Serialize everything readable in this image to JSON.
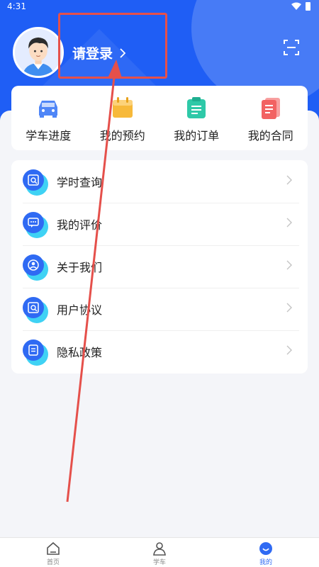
{
  "status_bar": {
    "time": "4:31"
  },
  "profile": {
    "login_text": "请登录"
  },
  "quick_actions": [
    {
      "label": "学车进度",
      "icon": "car-icon",
      "color": "#4f86f7"
    },
    {
      "label": "我的预约",
      "icon": "calendar-icon",
      "color": "#f7b93a"
    },
    {
      "label": "我的订单",
      "icon": "clipboard-icon",
      "color": "#2ec9a8"
    },
    {
      "label": "我的合同",
      "icon": "document-icon",
      "color": "#f26262"
    }
  ],
  "menu": [
    {
      "label": "学时查询",
      "icon": "hours-search-icon"
    },
    {
      "label": "我的评价",
      "icon": "comment-icon"
    },
    {
      "label": "关于我们",
      "icon": "person-icon"
    },
    {
      "label": "用户协议",
      "icon": "agreement-icon"
    },
    {
      "label": "隐私政策",
      "icon": "privacy-icon"
    }
  ],
  "tabbar": [
    {
      "label": "首页",
      "icon": "home-icon",
      "active": false
    },
    {
      "label": "学车",
      "icon": "driver-icon",
      "active": false
    },
    {
      "label": "我的",
      "icon": "profile-icon",
      "active": true
    }
  ],
  "colors": {
    "primary": "#1f5ef5",
    "accent": "#2f6af3",
    "annotation": "#e5504b"
  }
}
